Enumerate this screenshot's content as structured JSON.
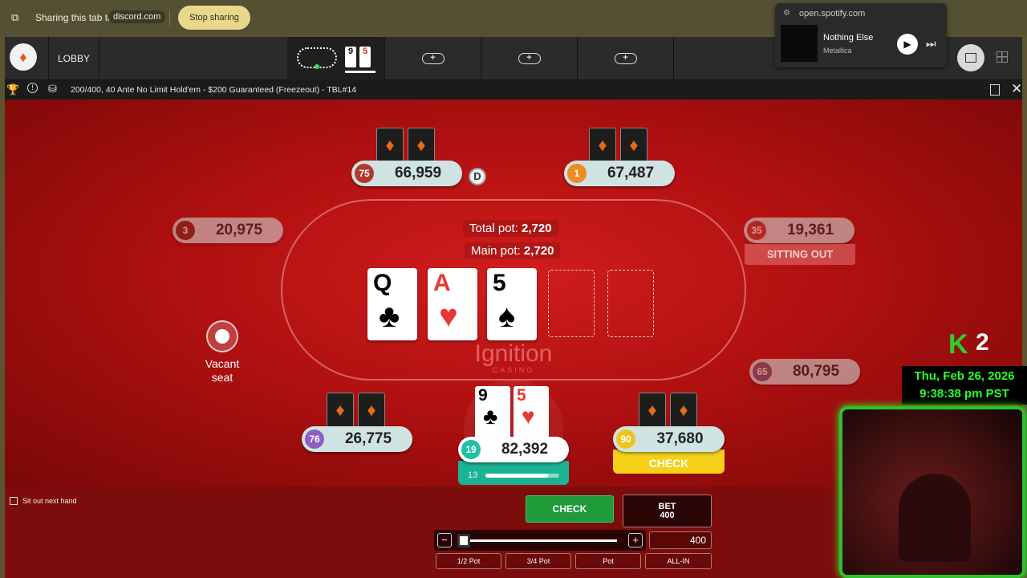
{
  "share_bar": {
    "text": "Sharing this tab to",
    "site": "discord.com",
    "stop_label": "Stop sharing"
  },
  "app_bar": {
    "lobby_label": "LOBBY",
    "mini_cards": [
      "9",
      "5"
    ],
    "add_tabs": [
      "+",
      "+",
      "+"
    ]
  },
  "spotify": {
    "host": "open.spotify.com",
    "track": "Nothing Else",
    "artist": "Metallica"
  },
  "title_bar": {
    "title": "200/400, 40 Ante No Limit Hold'em - $200 Guaranteed (Freezeout) - TBL#14"
  },
  "table": {
    "total_pot_label": "Total pot:",
    "total_pot": "2,720",
    "main_pot_label": "Main pot:",
    "main_pot": "2,720",
    "board": [
      {
        "rank": "Q",
        "suit": "♣",
        "color": "#222222"
      },
      {
        "rank": "A",
        "suit": "♥",
        "color": "#e53935"
      },
      {
        "rank": "5",
        "suit": "♠",
        "color": "#222222"
      }
    ],
    "dealer_button": "D",
    "logo": "Ignition",
    "logo_sub": "CASINO",
    "vacant": {
      "line1": "Vacant",
      "line2": "seat"
    }
  },
  "seats": [
    {
      "id": "top-left",
      "badge": "75",
      "stack": "66,959",
      "badge_color": "#b03a2e"
    },
    {
      "id": "top-right",
      "badge": "1",
      "stack": "67,487",
      "badge_color": "#f08a24"
    },
    {
      "id": "left",
      "badge": "3",
      "stack": "20,975",
      "badge_color": "#7b2a1c"
    },
    {
      "id": "right",
      "badge": "35",
      "stack": "19,361",
      "badge_color": "#b03a2e",
      "status": "SITTING OUT"
    },
    {
      "id": "right-lower",
      "badge": "65",
      "stack": "80,795",
      "badge_color": "#6c5b7b"
    },
    {
      "id": "bottom-left",
      "badge": "76",
      "stack": "26,775",
      "badge_color": "#8e5fc2"
    },
    {
      "id": "bottom-right",
      "badge": "90",
      "stack": "37,680",
      "badge_color": "#f0c41a",
      "status": "CHECK"
    }
  ],
  "hero": {
    "badge": "19",
    "stack": "82,392",
    "timer": "13",
    "timer_fraction": 0.85,
    "cards": [
      {
        "rank": "9",
        "suit": "♣",
        "color": "#222222"
      },
      {
        "rank": "5",
        "suit": "♥",
        "color": "#e53935"
      }
    ]
  },
  "controls": {
    "sit_out": "Sit out next hand",
    "check_label": "CHECK",
    "bet_label": "BET",
    "bet_amount": "400",
    "slider_minus": "−",
    "slider_plus": "+",
    "bet_input": "400",
    "presets": [
      "1/2 Pot",
      "3/4 Pot",
      "Pot",
      "ALL-IN"
    ]
  },
  "overlay": {
    "logo": "K",
    "count": "2",
    "clock_date": "Thu, Feb 26, 2026",
    "clock_time": "9:38:38 pm PST"
  }
}
